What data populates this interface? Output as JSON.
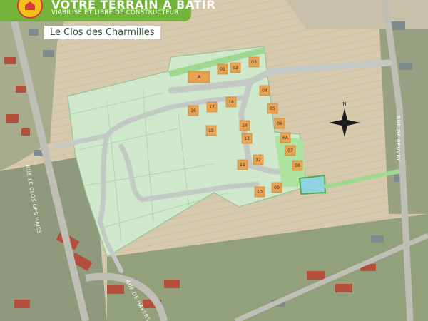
{
  "banner": {
    "line1": "VOTRE TERRAIN A BATIR",
    "line2": "VIABILISE ET LIBRE DE CONSTRUCTEUR"
  },
  "project_title": "Le Clos des Charmilles",
  "streets": {
    "clos_des_haies": "RUE LE CLOS DES HAIES",
    "beuvry": "RUE DE BEUVRY",
    "havers": "RUE DE HAVERS"
  },
  "plots": [
    "A",
    "01",
    "02",
    "03",
    "04",
    "05",
    "06",
    "6A",
    "07",
    "08",
    "09",
    "10",
    "11",
    "12",
    "13",
    "14",
    "15",
    "16",
    "17",
    "18"
  ],
  "colors": {
    "banner_green": "#74b33a",
    "plot_orange": "#e9a24f",
    "plot_green": "#b9e8b0",
    "development_green": "#cfe8cc",
    "road_grey": "#c4c9c6",
    "basin_blue": "#8fd3e0",
    "logo_yellow": "#f2c21a"
  },
  "compass": "N"
}
